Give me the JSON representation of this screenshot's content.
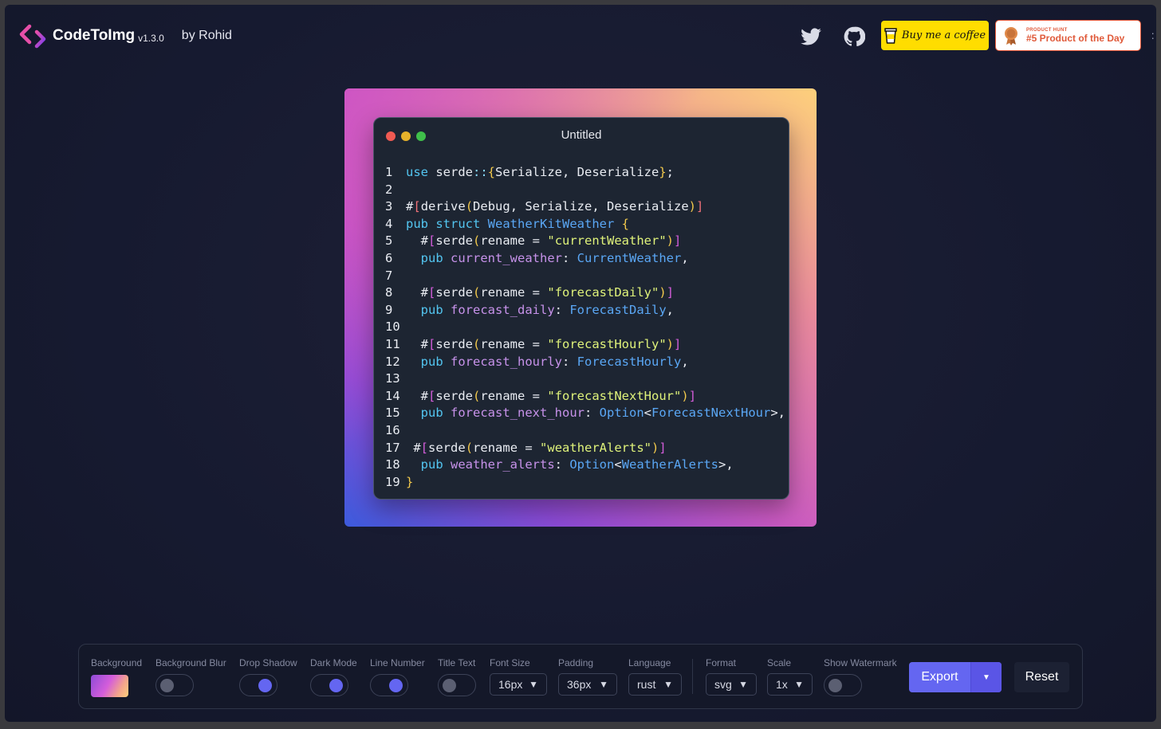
{
  "header": {
    "app_name": "CodeToImg",
    "version": "v1.3.0",
    "author": "by Rohid",
    "buy_me_coffee": "Buy me a coffee",
    "product_hunt_small": "PRODUCT HUNT",
    "product_hunt_big": "#5 Product of the Day",
    "icons": [
      "twitter-icon",
      "github-icon"
    ]
  },
  "editor": {
    "title": "Untitled",
    "line_numbers": [
      "1",
      "2",
      "3",
      "4",
      "5",
      "6",
      "7",
      "8",
      "9",
      "10",
      "11",
      "12",
      "13",
      "14",
      "15",
      "16",
      "17",
      "18",
      "19"
    ],
    "code_lines": [
      "use serde::{Serialize, Deserialize};",
      "",
      "#[derive(Debug, Serialize, Deserialize)]",
      "pub struct WeatherKitWeather {",
      "  #[serde(rename = \"currentWeather\")]",
      "  pub current_weather: CurrentWeather,",
      "",
      "  #[serde(rename = \"forecastDaily\")]",
      "  pub forecast_daily: ForecastDaily,",
      "",
      "  #[serde(rename = \"forecastHourly\")]",
      "  pub forecast_hourly: ForecastHourly,",
      "",
      "  #[serde(rename = \"forecastNextHour\")]",
      "  pub forecast_next_hour: Option<ForecastNextHour>,",
      "",
      " #[serde(rename = \"weatherAlerts\")]",
      "  pub weather_alerts: Option<WeatherAlerts>,",
      "}"
    ]
  },
  "toolbar": {
    "background_label": "Background",
    "background_blur_label": "Background Blur",
    "drop_shadow_label": "Drop Shadow",
    "dark_mode_label": "Dark Mode",
    "line_number_label": "Line Number",
    "title_text_label": "Title Text",
    "font_size_label": "Font Size",
    "font_size_value": "16px",
    "padding_label": "Padding",
    "padding_value": "36px",
    "language_label": "Language",
    "language_value": "rust",
    "format_label": "Format",
    "format_value": "svg",
    "scale_label": "Scale",
    "scale_value": "1x",
    "show_watermark_label": "Show Watermark",
    "export_label": "Export",
    "reset_label": "Reset",
    "toggles": {
      "background_blur": false,
      "drop_shadow": true,
      "dark_mode": true,
      "line_number": true,
      "title_text": false,
      "show_watermark": false
    }
  },
  "colors": {
    "accent": "#6466f1",
    "coffee_yellow": "#ffdd00",
    "product_hunt": "#e05a3a"
  }
}
